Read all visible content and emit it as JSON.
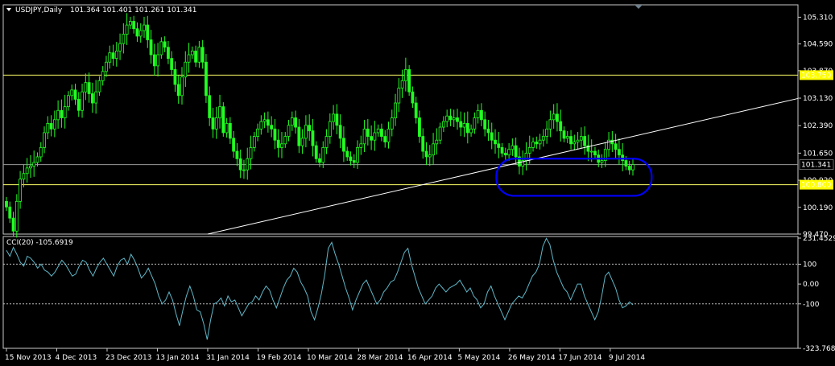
{
  "chart_data": {
    "type": "candlestick",
    "symbol_header": "USDJPY,Daily",
    "ohlc_header": "101.364 101.401 101.261 101.341",
    "price_scale": {
      "min": 99.47,
      "max": 105.6,
      "ticks": [
        "105.310",
        "104.590",
        "103.870",
        "103.130",
        "102.390",
        "101.650",
        "100.920",
        "100.190",
        "99.470"
      ]
    },
    "levels": [
      {
        "label": "103.750",
        "value": 103.75,
        "color": "#ffff66"
      },
      {
        "label": "100.800",
        "value": 100.8,
        "color": "#ffff66"
      }
    ],
    "current_price": {
      "label": "101.341",
      "value": 101.341
    },
    "trendline": {
      "x0": "31 Jan 2014",
      "y0": 99.47,
      "x1": "14 Jul 2014",
      "y1": 102.1
    },
    "highlight": {
      "shape": "rounded-rect",
      "color": "#0000ff",
      "x_from": "16 May 2014",
      "x_to": "10 Jul 2014",
      "y_from": 100.5,
      "y_to": 101.5
    },
    "date_ticks": [
      "15 Nov 2013",
      "4 Dec 2013",
      "23 Dec 2013",
      "13 Jan 2014",
      "31 Jan 2014",
      "19 Feb 2014",
      "10 Mar 2014",
      "28 Mar 2014",
      "16 Apr 2014",
      "5 May 2014",
      "26 May 2014",
      "17 Jun 2014",
      "9 Jul 2014"
    ],
    "closes": [
      100.2,
      99.9,
      99.55,
      100.35,
      100.95,
      101.1,
      101.25,
      101.3,
      101.4,
      101.55,
      101.8,
      102.2,
      102.45,
      102.3,
      102.55,
      102.8,
      102.6,
      102.9,
      103.2,
      103.35,
      103.1,
      102.8,
      103.3,
      103.55,
      103.25,
      103.0,
      103.3,
      103.6,
      103.85,
      104.1,
      104.35,
      104.2,
      104.4,
      104.6,
      104.85,
      105.1,
      105.2,
      105.0,
      104.8,
      104.95,
      105.1,
      104.7,
      104.3,
      104.0,
      104.3,
      104.65,
      104.5,
      104.2,
      103.9,
      103.5,
      103.2,
      103.7,
      104.1,
      104.3,
      104.4,
      104.1,
      104.5,
      104.1,
      103.2,
      102.6,
      102.3,
      102.6,
      102.9,
      102.2,
      102.45,
      102.05,
      101.7,
      101.5,
      101.2,
      101.2,
      101.5,
      101.8,
      102.1,
      102.3,
      102.5,
      102.55,
      102.4,
      102.3,
      102.0,
      101.8,
      101.9,
      102.1,
      102.4,
      102.6,
      102.35,
      101.85,
      102.05,
      102.4,
      102.25,
      101.85,
      101.5,
      101.4,
      101.8,
      102.1,
      102.5,
      102.7,
      102.4,
      102.05,
      101.7,
      101.55,
      101.45,
      101.4,
      101.8,
      101.9,
      102.3,
      102.1,
      102.0,
      102.2,
      102.3,
      102.1,
      101.95,
      102.3,
      102.6,
      103.0,
      103.4,
      103.6,
      103.9,
      103.3,
      103.0,
      102.6,
      102.1,
      101.7,
      101.55,
      101.6,
      101.9,
      102.0,
      102.35,
      102.5,
      102.65,
      102.55,
      102.6,
      102.5,
      102.35,
      102.45,
      102.2,
      102.3,
      102.6,
      102.8,
      102.55,
      102.3,
      102.2,
      102.0,
      101.9,
      101.8,
      101.65,
      101.6,
      101.75,
      101.85,
      101.55,
      101.3,
      101.45,
      101.65,
      101.8,
      101.95,
      101.9,
      102.0,
      102.1,
      102.3,
      102.55,
      102.7,
      102.5,
      102.25,
      102.05,
      102.1,
      101.9,
      101.95,
      102.0,
      102.1,
      101.85,
      101.7,
      101.7,
      101.6,
      101.4,
      101.45,
      101.75,
      102.0,
      101.9,
      101.75,
      101.6,
      101.45,
      101.3,
      101.2,
      101.34
    ],
    "cci": {
      "label": "CCI(20) -105.6919",
      "scale": {
        "max": 231.4529,
        "min": -323.768
      },
      "tick_labels": {
        "top": "231.4529",
        "plus100": "100",
        "zero": "0.00",
        "minus100": "-100",
        "bottom": "-323.768"
      },
      "levels": [
        100,
        -100
      ],
      "color": "#5fb7c8",
      "values": [
        170,
        140,
        185,
        150,
        110,
        90,
        140,
        130,
        110,
        80,
        100,
        70,
        60,
        40,
        60,
        90,
        120,
        100,
        70,
        40,
        50,
        90,
        120,
        110,
        70,
        40,
        80,
        110,
        130,
        100,
        70,
        40,
        90,
        120,
        130,
        100,
        150,
        120,
        80,
        30,
        50,
        80,
        40,
        0,
        -60,
        -100,
        -80,
        -40,
        -80,
        -150,
        -210,
        -130,
        -60,
        -10,
        -60,
        -130,
        -140,
        -200,
        -280,
        -180,
        -100,
        -90,
        -70,
        -110,
        -60,
        -90,
        -80,
        -120,
        -160,
        -130,
        -100,
        -90,
        -60,
        -80,
        -40,
        -10,
        -30,
        -80,
        -120,
        -70,
        -20,
        20,
        40,
        80,
        60,
        10,
        -20,
        -60,
        -140,
        -180,
        -120,
        -50,
        50,
        180,
        210,
        150,
        100,
        40,
        -20,
        -70,
        -130,
        -80,
        -40,
        0,
        20,
        -20,
        -60,
        -100,
        -80,
        -40,
        -20,
        10,
        20,
        60,
        110,
        160,
        180,
        100,
        40,
        -20,
        -60,
        -100,
        -80,
        -60,
        -20,
        0,
        -20,
        -40,
        -20,
        -10,
        0,
        20,
        -10,
        -40,
        -20,
        -60,
        -80,
        -120,
        -100,
        -40,
        -10,
        -60,
        -100,
        -140,
        -180,
        -140,
        -100,
        -80,
        -60,
        -70,
        -40,
        0,
        40,
        60,
        100,
        190,
        230,
        200,
        120,
        60,
        20,
        -20,
        -40,
        -80,
        -40,
        0,
        0,
        -60,
        -100,
        -140,
        -180,
        -140,
        -60,
        40,
        60,
        20,
        -20,
        -80,
        -120,
        -110,
        -90,
        -105
      ]
    }
  }
}
